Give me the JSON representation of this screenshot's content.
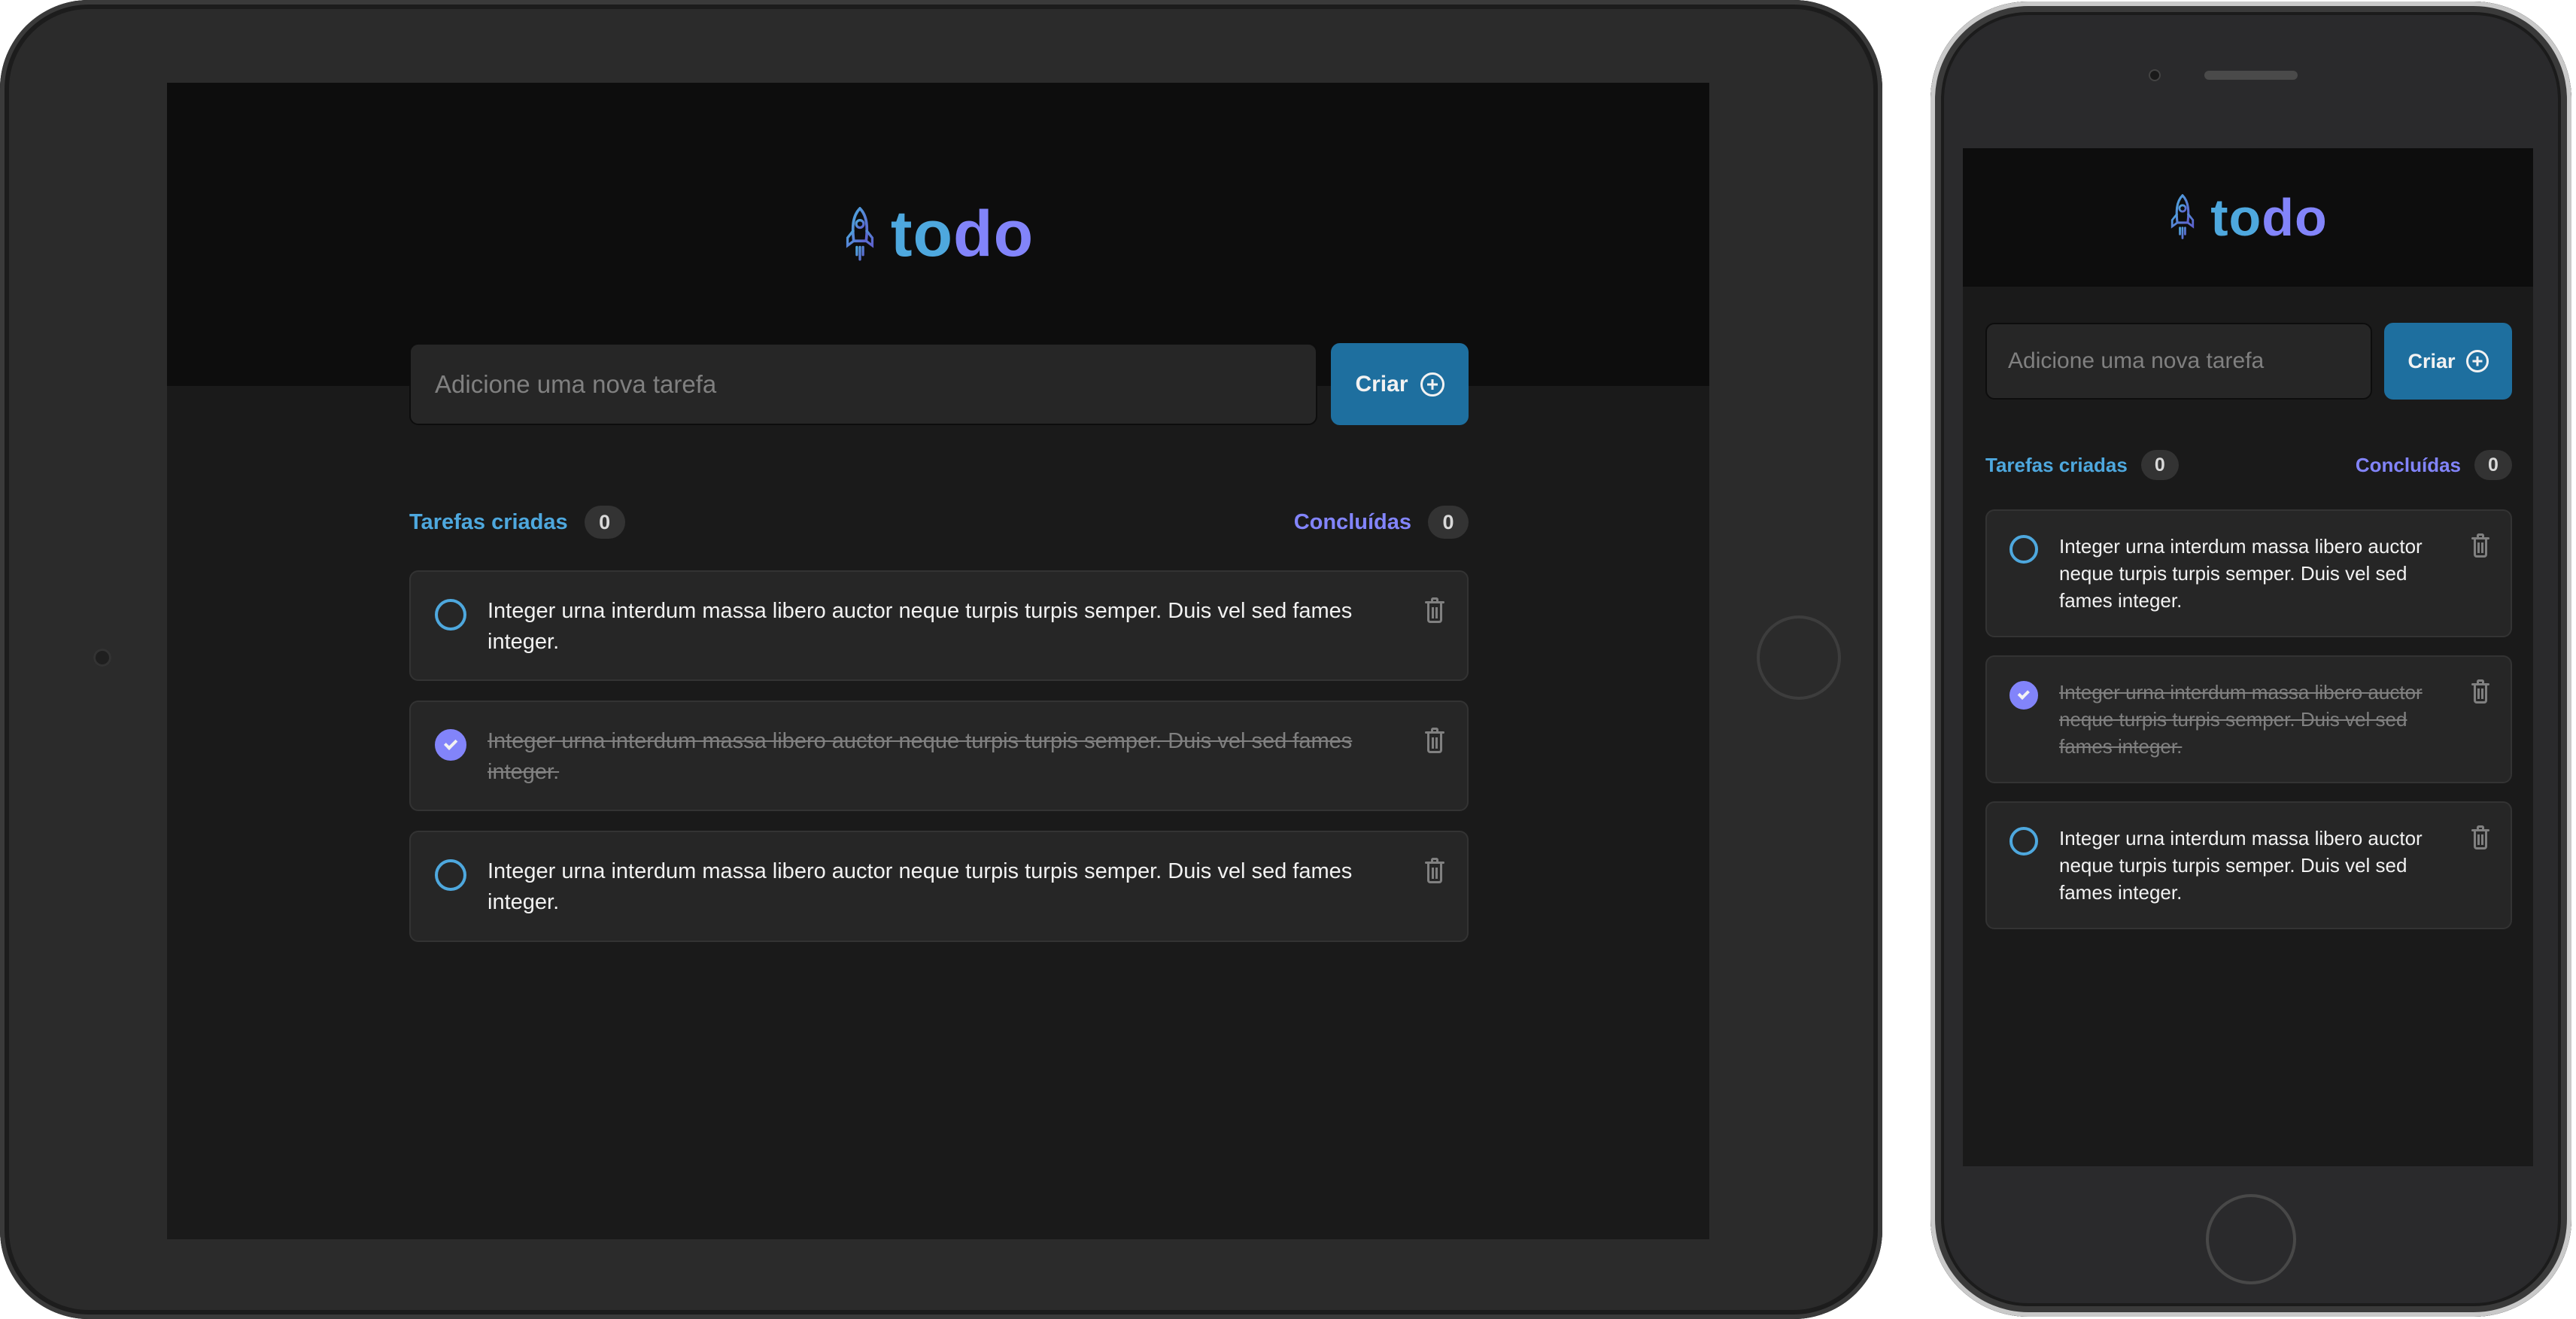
{
  "app": {
    "logo_text_a": "to",
    "logo_text_b": "do",
    "logo_icon": "rocket-icon"
  },
  "form": {
    "placeholder": "Adicione uma nova tarefa",
    "button_label": "Criar",
    "button_icon": "plus-circle-icon"
  },
  "counters": {
    "created_label": "Tarefas criadas",
    "created_count": "0",
    "done_label": "Concluídas",
    "done_count": "0"
  },
  "tasks": [
    {
      "text": "Integer urna interdum massa libero auctor neque turpis turpis semper. Duis vel sed fames integer.",
      "done": false
    },
    {
      "text": "Integer urna interdum massa libero auctor neque turpis turpis semper. Duis vel sed fames integer.",
      "done": true
    },
    {
      "text": "Integer urna interdum massa libero auctor neque turpis turpis semper. Duis vel sed fames integer.",
      "done": false
    }
  ],
  "colors": {
    "blue": "#4ea8de",
    "purple": "#8284fa",
    "button": "#1e6f9f",
    "background": "#1a1a1a",
    "header": "#0d0d0d"
  }
}
